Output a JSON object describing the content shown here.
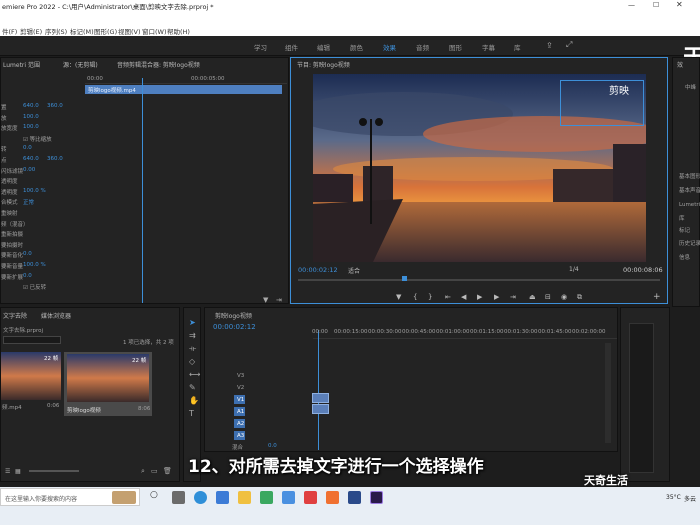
{
  "title_bar": {
    "title": "emiere Pro 2022 - C:\\用户\\Administrator\\桌面\\剪映文字去除.prproj *"
  },
  "menu": [
    "件(F)",
    "剪辑(E)",
    "序列(S)",
    "标记(M)",
    "图形(G)",
    "视图(V)",
    "窗口(W)",
    "帮助(H)"
  ],
  "workspaces": [
    "学习",
    "组件",
    "编辑",
    "颜色",
    "效果",
    "音频",
    "图形",
    "字幕",
    "库"
  ],
  "active_workspace": "效果",
  "brand_glyph": "天",
  "effect_controls": {
    "tabs": [
      "Lumetri 范围",
      "源：(无剪辑)",
      "音频剪辑混合器: 剪映logo视频",
      "效果控件"
    ],
    "clip_name": "剪映logo视频.mp4",
    "ruler": [
      "00:00",
      "00:00:05:00"
    ],
    "props": [
      {
        "label": "置",
        "v1": "640.0",
        "v2": "360.0"
      },
      {
        "label": "放",
        "v1": "100.0"
      },
      {
        "label": "放宽度",
        "v1": "100.0"
      },
      {
        "label": "",
        "check": "等比缩放"
      },
      {
        "label": "转",
        "v1": "0.0"
      },
      {
        "label": "点",
        "v1": "640.0",
        "v2": "360.0"
      },
      {
        "label": "闪烁滤镜",
        "v1": "0.00"
      },
      {
        "label": "透明度"
      },
      {
        "label": "透明度",
        "v1": "100.0 %"
      },
      {
        "label": "合模式",
        "v1": "正常"
      },
      {
        "label": "重映射"
      },
      {
        "label": "频（混音）"
      },
      {
        "label": "重新拍摄"
      },
      {
        "label": "要拍摄时"
      },
      {
        "label": "要新音化",
        "v1": "0.0"
      },
      {
        "label": "要新音量",
        "v1": "100.0 %"
      },
      {
        "label": "要新扩展",
        "v1": "0.0"
      },
      {
        "label": "",
        "check": "已反转"
      }
    ]
  },
  "program_monitor": {
    "tab": "节目: 剪映logo视频",
    "timecode": "00:00:02:12",
    "fit": "适合",
    "quality": "1/4",
    "duration": "00:00:08:06",
    "logo_text": "剪映"
  },
  "project_panel": {
    "tabs": [
      "文字去除",
      "媒体浏览器"
    ],
    "file": "文字去除.prproj",
    "selection_info": "1 项已选择，共 2 项",
    "items": [
      {
        "name": "频.mp4",
        "duration": "0:06",
        "badge": "22 帧"
      },
      {
        "name": "剪映logo视频",
        "duration": "8:06",
        "badge": "22 帧"
      }
    ]
  },
  "timeline": {
    "tab": "剪映logo视频",
    "timecode": "00:00:02:12",
    "ruler": [
      "00:00",
      "00:00:15:00",
      "00:00:30:00",
      "00:00:45:00",
      "00:01:00:00",
      "00:01:15:00",
      "00:01:30:00",
      "00:01:45:00",
      "00:02:00:00",
      "00:02:15:00"
    ],
    "tracks": [
      "V3",
      "V2",
      "V1",
      "A1",
      "A2",
      "A3"
    ],
    "mix_label": "混合",
    "mix_value": "0.0"
  },
  "right_panel": {
    "labels": [
      "效",
      "中峰",
      "基本图形",
      "基本声音",
      "Lumetri 颜色",
      "库",
      "标记",
      "历史记录",
      "信息"
    ]
  },
  "caption": "12、对所需去掉文字进行一个选择操作",
  "watermark": "天奇生活",
  "taskbar": {
    "search_placeholder": "在这里输入你要搜索的内容",
    "weather": "35°C",
    "weather_desc": "多云"
  },
  "colors": {
    "accent": "#3d8fd8",
    "panel": "#232323",
    "bg": "#1d1d1d"
  }
}
